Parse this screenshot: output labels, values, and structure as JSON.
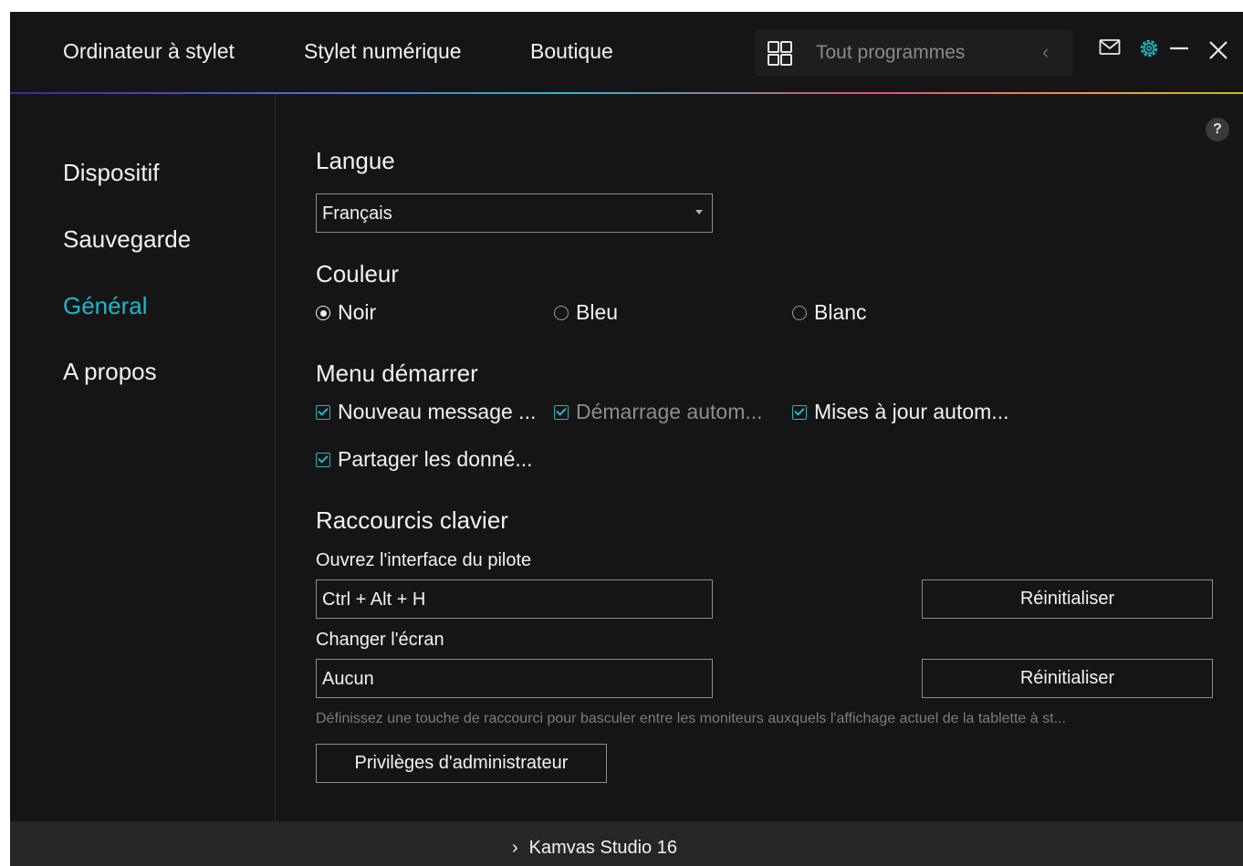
{
  "topbar": {
    "nav": [
      "Ordinateur à stylet",
      "Stylet numérique",
      "Boutique"
    ],
    "programs_placeholder": "Tout programmes",
    "icons": [
      "grid-icon",
      "chevron-left-icon",
      "mail-icon",
      "gear-icon",
      "minimize-icon",
      "close-icon"
    ],
    "accent_color": "#1eb7c9"
  },
  "sidebar": {
    "items": [
      {
        "label": "Dispositif"
      },
      {
        "label": "Sauvegarde"
      },
      {
        "label": "Général"
      },
      {
        "label": "A propos"
      }
    ],
    "active": "Général"
  },
  "main": {
    "help": "?",
    "language": {
      "title": "Langue",
      "value": "Français"
    },
    "color": {
      "title": "Couleur",
      "options": [
        "Noir",
        "Bleu",
        "Blanc"
      ],
      "selected": "Noir"
    },
    "start_menu": {
      "title": "Menu démarrer",
      "items": [
        {
          "label": "Nouveau message ...",
          "checked": true
        },
        {
          "label": "Démarrage autom...",
          "checked": true
        },
        {
          "label": "Mises à jour autom...",
          "checked": true
        },
        {
          "label": "Partager les donné...",
          "checked": true
        }
      ]
    },
    "shortcuts": {
      "title": "Raccourcis clavier",
      "open_label": "Ouvrez l'interface du pilote",
      "open_value": "Ctrl + Alt + H",
      "switch_label": "Changer l'écran",
      "switch_value": "Aucun",
      "reset_label": "Réinitialiser",
      "hint": "Définissez une touche de raccourci pour basculer entre les moniteurs auxquels l'affichage actuel de la tablette à st...",
      "admin_label": "Privilèges d'administrateur"
    }
  },
  "bottombar": {
    "device": "Kamvas Studio 16"
  }
}
